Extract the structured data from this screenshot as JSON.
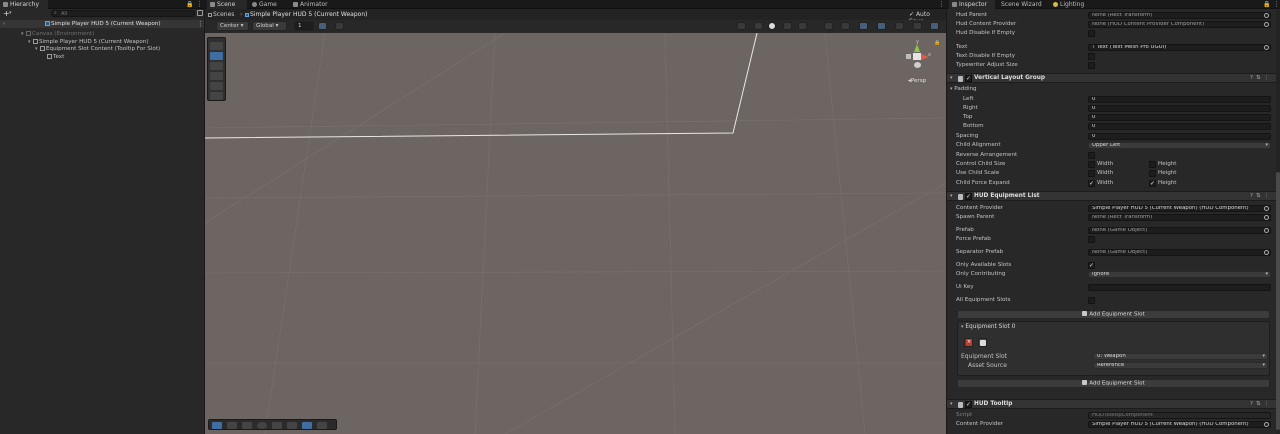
{
  "hierarchy": {
    "tab_label": "Hierarchy",
    "search_placeholder": "All",
    "add_button_label": "+",
    "scene_root": "Simple Player HUD 5 (Current Weapon)",
    "items": [
      {
        "label": "Canvas (Environment)",
        "depth": 1,
        "muted": true
      },
      {
        "label": "Simple Player HUD 5 (Current Weapon)",
        "depth": 2,
        "muted": false
      },
      {
        "label": "Equipment Slot Content (Tooltip For Slot)",
        "depth": 3,
        "muted": false
      },
      {
        "label": "Text",
        "depth": 4,
        "muted": false
      }
    ]
  },
  "scene": {
    "tabs": [
      "Scene",
      "Game",
      "Animator"
    ],
    "breadcrumb_root": "Scenes",
    "breadcrumb_current": "Simple Player HUD 5 (Current Weapon)",
    "auto_save_label": "Auto Save",
    "pivot_label": "Center",
    "space_label": "Global",
    "grid_value": "1",
    "persp_label": "Persp",
    "gizmo_y_label": "y",
    "gizmo_x_label": "x"
  },
  "inspector": {
    "tabs": [
      "Inspector",
      "Scene Wizard",
      "Lighting"
    ],
    "top_fields": [
      {
        "label": "Hud Parent",
        "value": "None (Rect Transform)"
      },
      {
        "label": "Hud Content Provider",
        "value": "None (HUD Content Provider Component)"
      }
    ],
    "hud_disable_if_empty_label": "Hud Disable If Empty",
    "text_label": "Text",
    "text_value": "Text (Text Mesh Pro UGUI)",
    "text_disable_if_empty_label": "Text Disable If Empty",
    "typewriter_adjust_size_label": "Typewriter Adjust Size",
    "vlg": {
      "title": "Vertical Layout Group",
      "padding_label": "Padding",
      "padding": [
        {
          "label": "Left",
          "value": "0"
        },
        {
          "label": "Right",
          "value": "0"
        },
        {
          "label": "Top",
          "value": "0"
        },
        {
          "label": "Bottom",
          "value": "0"
        }
      ],
      "spacing_label": "Spacing",
      "spacing_value": "0",
      "child_alignment_label": "Child Alignment",
      "child_alignment_value": "Upper Left",
      "reverse_label": "Reverse Arrangement",
      "control_label": "Control Child Size",
      "scale_label": "Use Child Scale",
      "expand_label": "Child Force Expand",
      "width_label": "Width",
      "height_label": "Height"
    },
    "equip_list": {
      "title": "HUD Equipment List",
      "content_provider_label": "Content Provider",
      "content_provider_value": "Simple Player HUD 5 (Current Weapon) (HUD Component)",
      "spawn_parent_label": "Spawn Parent",
      "spawn_parent_value": "None (Rect Transform)",
      "prefab_label": "Prefab",
      "prefab_value": "None (Game Object)",
      "force_prefab_label": "Force Prefab",
      "separator_prefab_label": "Separator Prefab",
      "separator_prefab_value": "None (Game Object)",
      "only_available_label": "Only Available Slots",
      "only_contributing_label": "Only Contributing",
      "only_contributing_value": "Ignore",
      "ui_key_label": "Ui Key",
      "ui_key_value": "",
      "all_slots_label": "All Equipment Slots",
      "add_slot_label": "Add Equipment Slot",
      "slot_title": "Equipment Slot 0",
      "equipment_slot_label": "Equipment Slot",
      "equipment_slot_value": "0: Weapon",
      "asset_source_label": "Asset Source",
      "asset_source_value": "Reference"
    },
    "tooltip": {
      "title": "HUD Tooltip",
      "script_label": "Script",
      "script_value": "HUDTooltipComponent",
      "content_provider_label": "Content Provider",
      "content_provider_value": "Simple Player HUD 5 (Current Weapon) (HUD Component)"
    }
  }
}
